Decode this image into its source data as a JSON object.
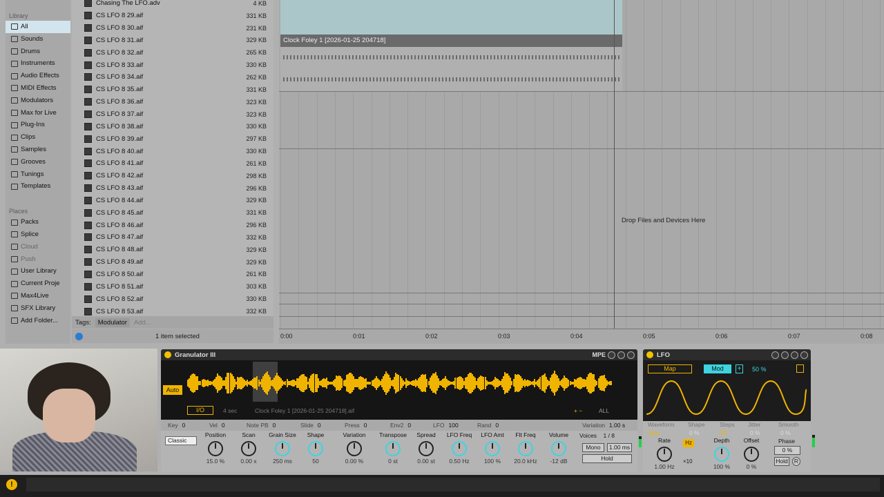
{
  "browser": {
    "library_heading": "Library",
    "library_items": [
      {
        "label": "All",
        "selected": true
      },
      {
        "label": "Sounds"
      },
      {
        "label": "Drums"
      },
      {
        "label": "Instruments"
      },
      {
        "label": "Audio Effects"
      },
      {
        "label": "MIDI Effects"
      },
      {
        "label": "Modulators"
      },
      {
        "label": "Max for Live"
      },
      {
        "label": "Plug-Ins"
      },
      {
        "label": "Clips"
      },
      {
        "label": "Samples"
      },
      {
        "label": "Grooves"
      },
      {
        "label": "Tunings"
      },
      {
        "label": "Templates"
      }
    ],
    "places_heading": "Places",
    "places_items": [
      {
        "label": "Packs"
      },
      {
        "label": "Splice"
      },
      {
        "label": "Cloud",
        "dim": true
      },
      {
        "label": "Push",
        "dim": true
      },
      {
        "label": "User Library"
      },
      {
        "label": "Current Proje"
      },
      {
        "label": "Max4Live"
      },
      {
        "label": "SFX Library"
      },
      {
        "label": "Add Folder..."
      }
    ],
    "files": [
      {
        "name": "Chasing The LFO.adv",
        "size": "4 KB"
      },
      {
        "name": "CS LFO 8 29.aif",
        "size": "331 KB"
      },
      {
        "name": "CS LFO 8 30.aif",
        "size": "231 KB"
      },
      {
        "name": "CS LFO 8 31.aif",
        "size": "329 KB"
      },
      {
        "name": "CS LFO 8 32.aif",
        "size": "265 KB"
      },
      {
        "name": "CS LFO 8 33.aif",
        "size": "330 KB"
      },
      {
        "name": "CS LFO 8 34.aif",
        "size": "262 KB"
      },
      {
        "name": "CS LFO 8 35.aif",
        "size": "331 KB"
      },
      {
        "name": "CS LFO 8 36.aif",
        "size": "323 KB"
      },
      {
        "name": "CS LFO 8 37.aif",
        "size": "323 KB"
      },
      {
        "name": "CS LFO 8 38.aif",
        "size": "330 KB"
      },
      {
        "name": "CS LFO 8 39.aif",
        "size": "297 KB"
      },
      {
        "name": "CS LFO 8 40.aif",
        "size": "330 KB"
      },
      {
        "name": "CS LFO 8 41.aif",
        "size": "261 KB"
      },
      {
        "name": "CS LFO 8 42.aif",
        "size": "298 KB"
      },
      {
        "name": "CS LFO 8 43.aif",
        "size": "296 KB"
      },
      {
        "name": "CS LFO 8 44.aif",
        "size": "329 KB"
      },
      {
        "name": "CS LFO 8 45.aif",
        "size": "331 KB"
      },
      {
        "name": "CS LFO 8 46.aif",
        "size": "296 KB"
      },
      {
        "name": "CS LFO 8 47.aif",
        "size": "332 KB"
      },
      {
        "name": "CS LFO 8 48.aif",
        "size": "329 KB"
      },
      {
        "name": "CS LFO 8 49.aif",
        "size": "329 KB"
      },
      {
        "name": "CS LFO 8 50.aif",
        "size": "261 KB"
      },
      {
        "name": "CS LFO 8 51.aif",
        "size": "303 KB"
      },
      {
        "name": "CS LFO 8 52.aif",
        "size": "330 KB"
      },
      {
        "name": "CS LFO 8 53.aif",
        "size": "332 KB"
      }
    ],
    "tags_label": "Tags:",
    "tag": "Modulator",
    "tag_add": "Add...",
    "status": "1 item selected"
  },
  "arrangement": {
    "clip_name": "Clock Foley 1 [2026-01-25 204718]",
    "drop_hint": "Drop Files and Devices Here",
    "ruler": [
      "0:00",
      "0:01",
      "0:02",
      "0:03",
      "0:04",
      "0:05",
      "0:06",
      "0:07",
      "0:08"
    ]
  },
  "granulator": {
    "title": "Granulator III",
    "mpe": "MPE",
    "auto": "Auto",
    "io": "I/O",
    "duration": "4 sec",
    "file": "Clock Foley 1 [2026-01-25 204718].aif",
    "all": "ALL",
    "strip": [
      {
        "label": "Key",
        "value": "0"
      },
      {
        "label": "Vel",
        "value": "0"
      },
      {
        "label": "Note PB",
        "value": "0"
      },
      {
        "label": "Slide",
        "value": "0"
      },
      {
        "label": "Press",
        "value": "0"
      },
      {
        "label": "Env2",
        "value": "0"
      },
      {
        "label": "LFO",
        "value": "100"
      },
      {
        "label": "Rand",
        "value": "0"
      },
      {
        "label": "Variation",
        "value": "1.00 s"
      }
    ],
    "mode": "Classic",
    "knobs": [
      {
        "label": "Position",
        "value": "15.0 %",
        "cyan": false
      },
      {
        "label": "Scan",
        "value": "0.00 x",
        "cyan": false
      },
      {
        "label": "Grain Size",
        "value": "250 ms",
        "cyan": true
      },
      {
        "label": "Shape",
        "value": "50",
        "cyan": true
      },
      {
        "label": "Variation",
        "value": "0.00 %",
        "cyan": false
      },
      {
        "label": "Transpose",
        "value": "0 st",
        "cyan": true
      },
      {
        "label": "Spread",
        "value": "0.00 st",
        "cyan": false
      },
      {
        "label": "LFO Freq",
        "value": "0.50 Hz",
        "cyan": true
      },
      {
        "label": "LFO Amt",
        "value": "100 %",
        "cyan": true
      },
      {
        "label": "Flt Freq",
        "value": "20.0 kHz",
        "cyan": true
      },
      {
        "label": "Volume",
        "value": "-12 dB",
        "cyan": true
      }
    ],
    "voices_label": "Voices",
    "voices_value": "1 / 8",
    "mono": "Mono",
    "mono_time": "1.00 ms",
    "hold": "Hold"
  },
  "lfo": {
    "title": "LFO",
    "map": "Map",
    "mod": "Mod",
    "depth_pct": "50 %",
    "labels": [
      "Waveform",
      "Shape",
      "Steps",
      "Jitter",
      "Smooth"
    ],
    "values": [
      "Sine",
      "0 %",
      "Off",
      "0 %",
      "0 %"
    ],
    "rate_label": "Rate",
    "rate_value": "1.00 Hz",
    "hz": "Hz",
    "x10": "×10",
    "depth_label": "Depth",
    "depth_value": "100 %",
    "offset_label": "Offset",
    "offset_value": "0 %",
    "phase_label": "Phase",
    "phase_value": "0 %",
    "hold": "Hold",
    "r": "R"
  },
  "colors": {
    "accent": "#f0b400",
    "cyan": "#3dd4e0",
    "meter": "#22d04a"
  }
}
